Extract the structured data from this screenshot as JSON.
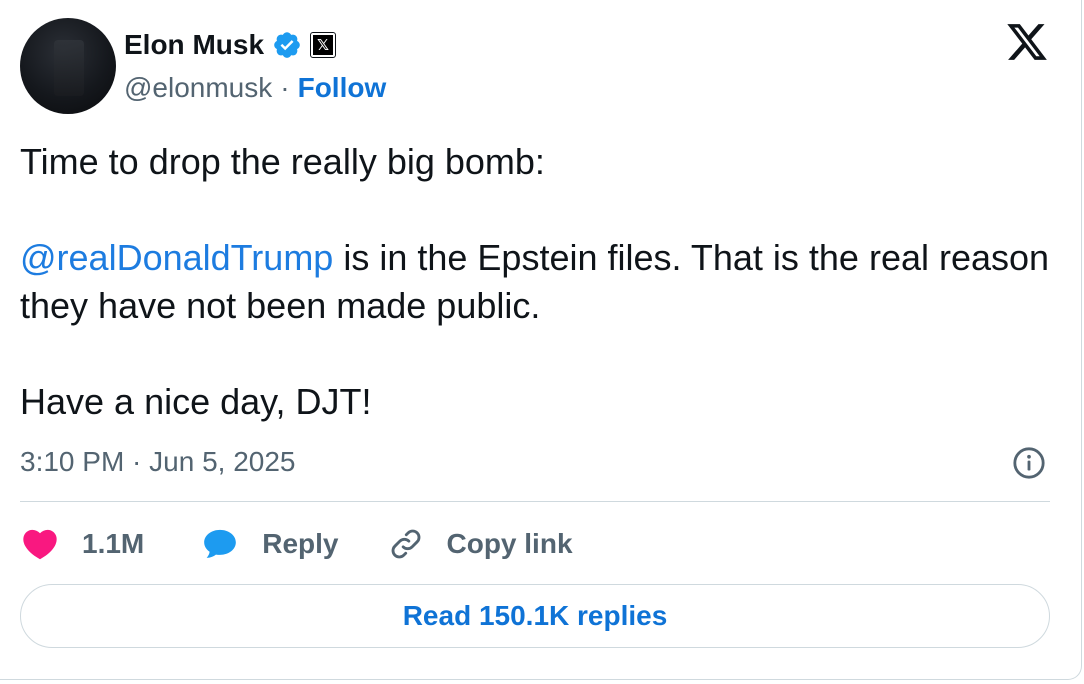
{
  "author": {
    "name": "Elon Musk",
    "handle": "@elonmusk",
    "separator": "·",
    "follow_label": "Follow",
    "affiliate_badge": "𝕏"
  },
  "tweet": {
    "line1": "Time to drop the really big bomb:",
    "mention": "@realDonaldTrump",
    "line2_rest": " is in the Epstein files. That is the real reason they have not been made public.",
    "line3": "Have a nice day, DJT!",
    "timestamp": "3:10 PM · Jun 5, 2025"
  },
  "actions": {
    "likes_count": "1.1M",
    "reply_label": "Reply",
    "copy_link_label": "Copy link"
  },
  "read_replies_label": "Read 150.1K replies",
  "colors": {
    "link_blue": "#1d7ce0",
    "verified_blue": "#1d9bf0",
    "heart_pink": "#f91880",
    "secondary_gray": "#536471"
  },
  "icons": [
    "verified-badge-icon",
    "x-affiliate-icon",
    "x-logo-icon",
    "info-icon",
    "heart-icon",
    "reply-bubble-icon",
    "link-icon"
  ]
}
